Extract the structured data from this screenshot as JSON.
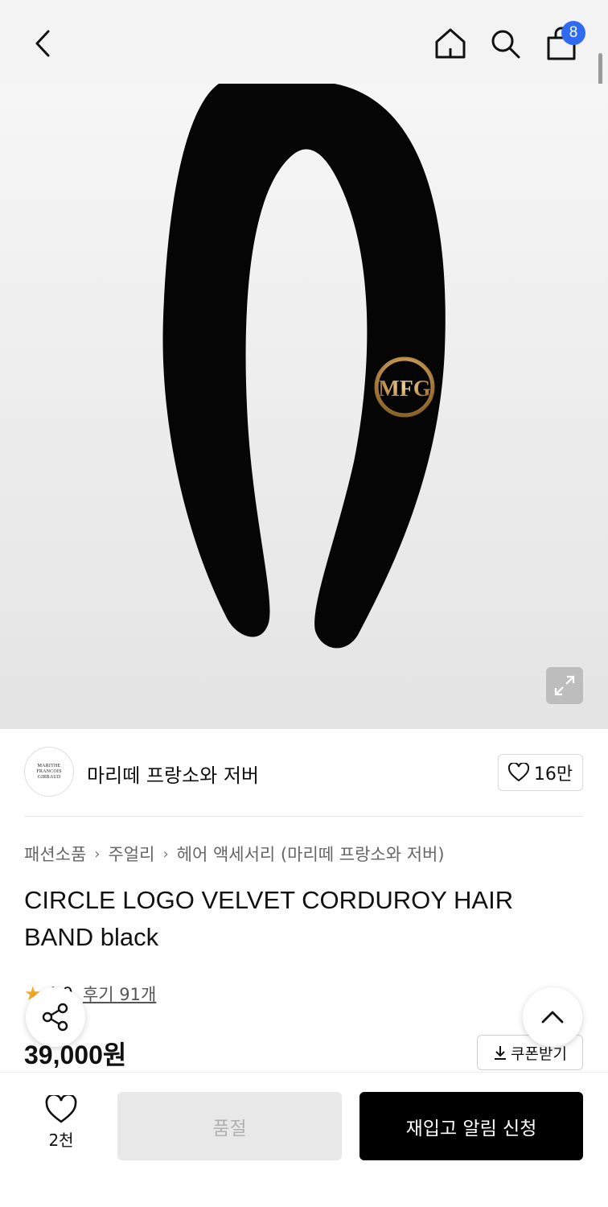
{
  "header": {
    "back_icon": "chevron-left-icon",
    "home_icon": "home-icon",
    "search_icon": "search-icon",
    "cart_icon": "shopping-bag-icon",
    "cart_count": "8",
    "badge_color": "#2f6bf2"
  },
  "hero": {
    "image_subject": "black velvet headband with gold circular MFG logo",
    "logo_text": "MFG",
    "expand_icon": "expand-icon"
  },
  "brand": {
    "logo_text": [
      "MARITHE",
      "FRANCOIS",
      "GIRBAUD"
    ],
    "name": "마리떼 프랑소와 저버",
    "likes": "16만"
  },
  "breadcrumb": [
    "패션소품",
    "주얼리",
    "헤어 액세서리 (마리떼 프랑소와 저버)"
  ],
  "product": {
    "title": "CIRCLE LOGO VELVET CORDUROY HAIR BAND black",
    "rating": "4.9",
    "reviews": "후기 91개",
    "price": "39,000원",
    "coupon_label": "쿠폰받기"
  },
  "floating": {
    "share_icon": "share-icon",
    "top_icon": "chevron-up-icon"
  },
  "bottom_bar": {
    "wish_count": "2천",
    "soldout_label": "품절",
    "restock_label": "재입고 알림 신청"
  },
  "colors": {
    "accent_star": "#f5a623",
    "primary_button": "#000000",
    "disabled_button": "#e8e8e8"
  }
}
